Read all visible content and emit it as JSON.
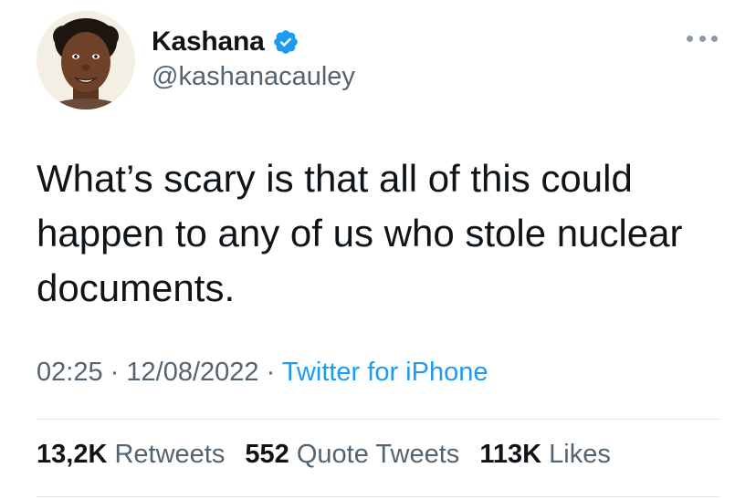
{
  "author": {
    "display_name": "Kashana",
    "handle": "@kashanacauley",
    "verified": true,
    "avatar": "profile-photo"
  },
  "tweet": {
    "text": "What’s scary is that all of this could happen to any of us who stole nuclear documents."
  },
  "meta": {
    "time": "02:25",
    "separator": "·",
    "date": "12/08/2022",
    "source": "Twitter for iPhone"
  },
  "stats": {
    "retweets_count": "13,2K",
    "retweets_label": "Retweets",
    "quotes_count": "552",
    "quotes_label": "Quote Tweets",
    "likes_count": "113K",
    "likes_label": "Likes"
  },
  "icons": {
    "verified": "verified-badge-icon",
    "more": "more-options-icon"
  },
  "colors": {
    "text_primary": "#0f1419",
    "text_secondary": "#536471",
    "accent": "#1d9bf0",
    "divider": "#e1e6ea"
  }
}
